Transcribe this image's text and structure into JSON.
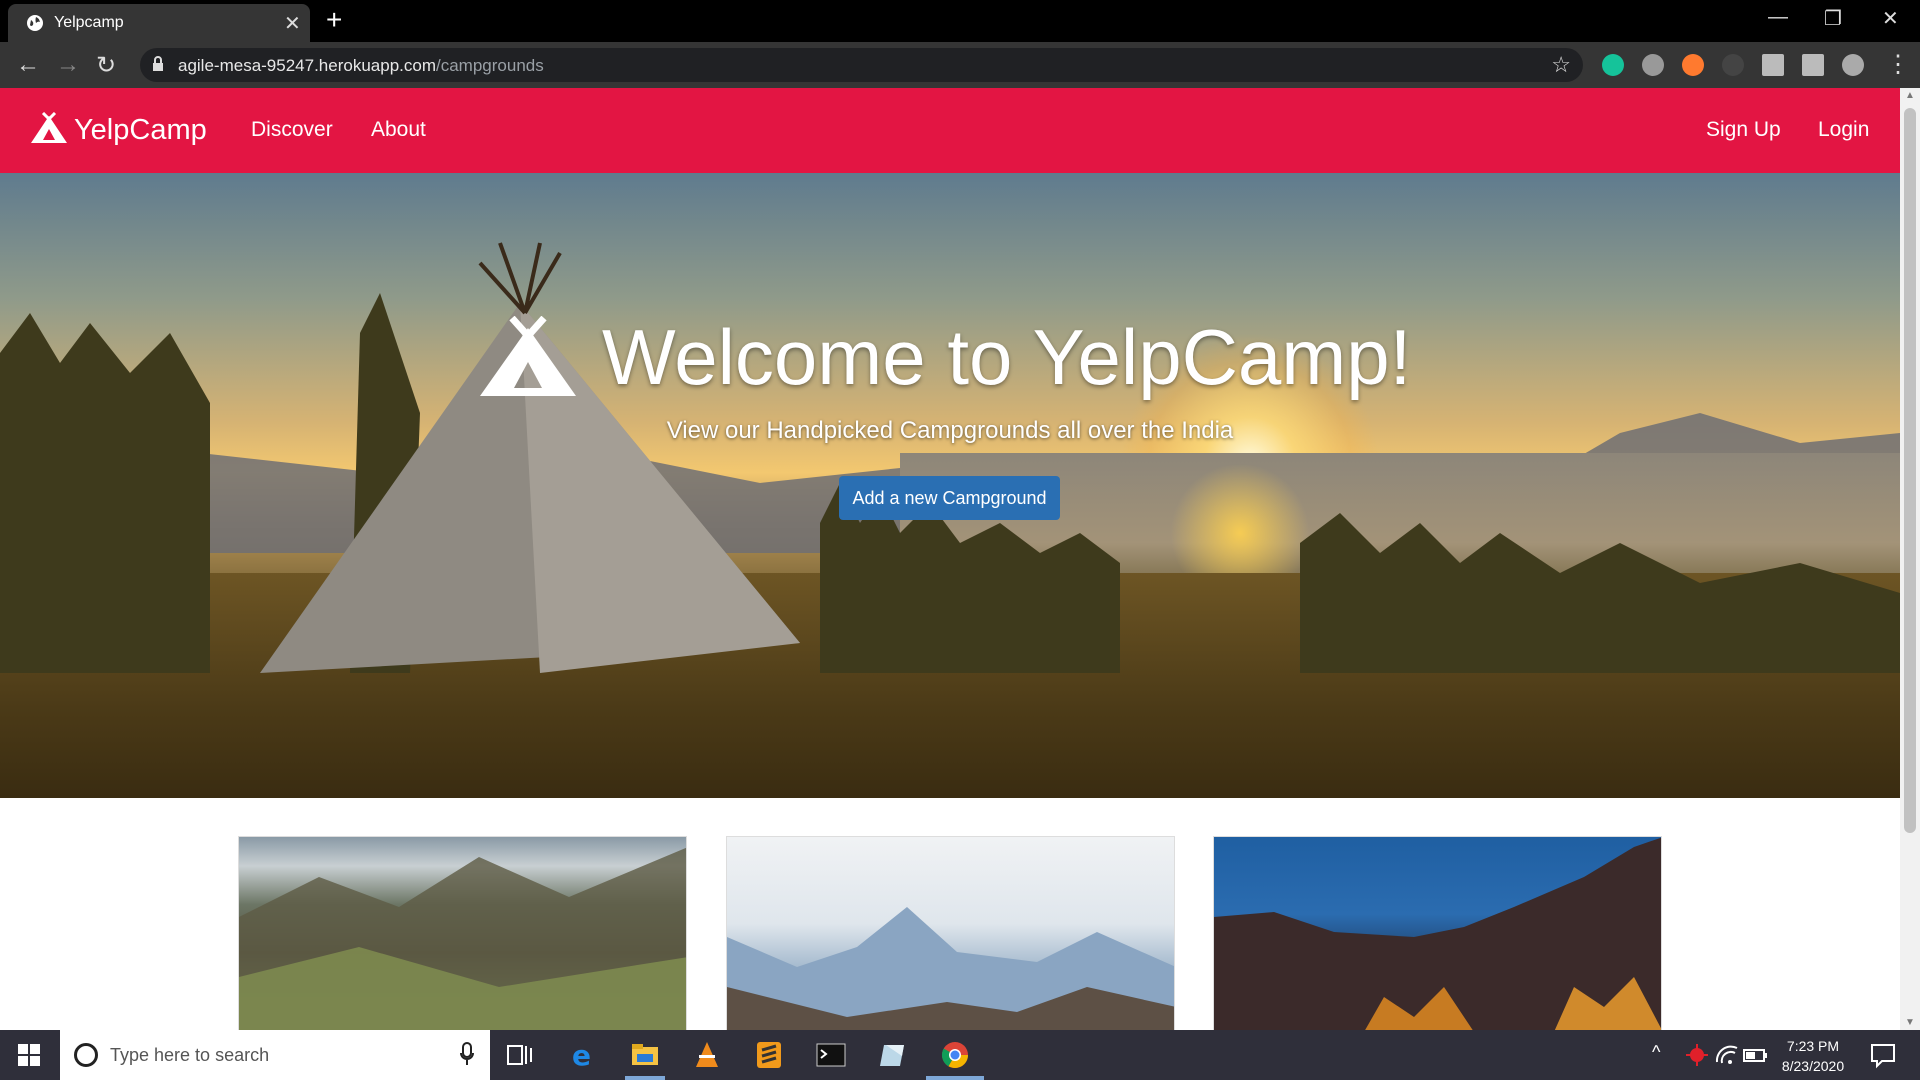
{
  "browser": {
    "tab_title": "Yelpcamp",
    "tab_close": "✕",
    "new_tab": "+",
    "url_host": "agile-mesa-95247.herokuapp.com",
    "url_path": "/campgrounds",
    "window_controls": [
      "—",
      "❐",
      "✕"
    ]
  },
  "navbar": {
    "brand": "YelpCamp",
    "links": [
      "Discover",
      "About"
    ],
    "right_links": [
      "Sign Up",
      "Login"
    ]
  },
  "hero": {
    "title": "Welcome to YelpCamp!",
    "subtitle": "View our Handpicked Campgrounds all over the India",
    "button_label": "Add a new Campground"
  },
  "taskbar": {
    "search_placeholder": "Type here to search",
    "time": "7:23 PM",
    "date": "8/23/2020"
  },
  "colors": {
    "navbar": "#e31543",
    "primary_button": "#2a6fb3"
  }
}
